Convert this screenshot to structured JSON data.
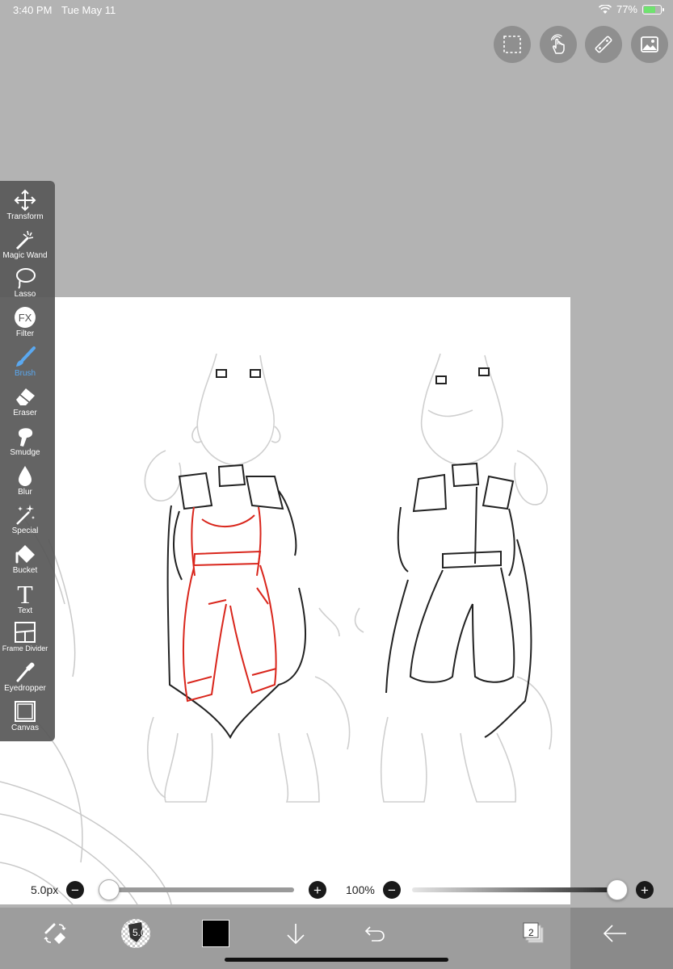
{
  "status": {
    "time": "3:40 PM",
    "date": "Tue May 11",
    "battery": "77%",
    "battery_level": 0.77
  },
  "top_actions": [
    {
      "name": "selection-button",
      "icon": "dashed-selection-icon"
    },
    {
      "name": "gesture-button",
      "icon": "hand-touch-icon"
    },
    {
      "name": "ruler-button",
      "icon": "ruler-icon"
    },
    {
      "name": "material-button",
      "icon": "image-icon"
    }
  ],
  "toolbar": {
    "transform": "Transform",
    "magic_wand": "Magic Wand",
    "lasso": "Lasso",
    "filter": "Filter",
    "filter_icon_text": "FX",
    "brush": "Brush",
    "eraser": "Eraser",
    "smudge": "Smudge",
    "blur": "Blur",
    "special": "Special",
    "bucket": "Bucket",
    "text": "Text",
    "text_icon_glyph": "T",
    "frame_divider": "Frame Divider",
    "eyedropper": "Eyedropper",
    "canvas": "Canvas",
    "active_tool": "Brush"
  },
  "brush_size": {
    "value": "5.0px",
    "slider_fraction": 0.0
  },
  "opacity": {
    "value": "100%",
    "slider_fraction": 1.0
  },
  "bottom_bar": {
    "brush_preview_size": "5.0",
    "color": "#000000",
    "layer_count": "2"
  },
  "colors": {
    "accent": "#5aa8f0",
    "sketch_red": "#d9261c"
  }
}
